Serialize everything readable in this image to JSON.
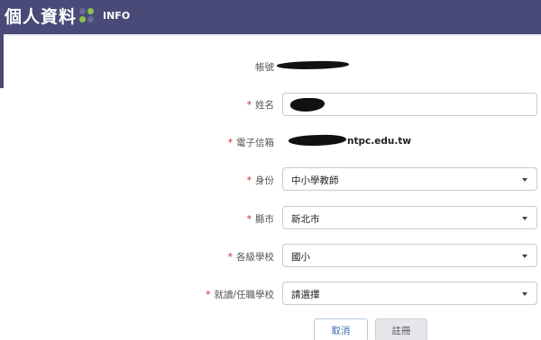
{
  "header": {
    "title": "個人資料",
    "subtitle": "INFO",
    "dot_colors": [
      "#6b6b9a",
      "#8bc34a",
      "#8bc34a",
      "#6b6b9a"
    ]
  },
  "form": {
    "account_label": "帳號",
    "name_label": "姓名",
    "email_label": "電子信箱",
    "email_value_suffix": "ntpc.edu.tw",
    "identity_label": "身份",
    "identity_value": "中小學教師",
    "county_label": "縣市",
    "county_value": "新北市",
    "school_level_label": "各級學校",
    "school_level_value": "國小",
    "school_label": "就讀/任職學校",
    "school_value": "請選擇",
    "required_mark": "*"
  },
  "buttons": {
    "cancel": "取消",
    "register": "註冊"
  },
  "colors": {
    "header_bg": "#4a4a78",
    "required": "#cc2222",
    "cancel_text": "#3a6bb0"
  }
}
